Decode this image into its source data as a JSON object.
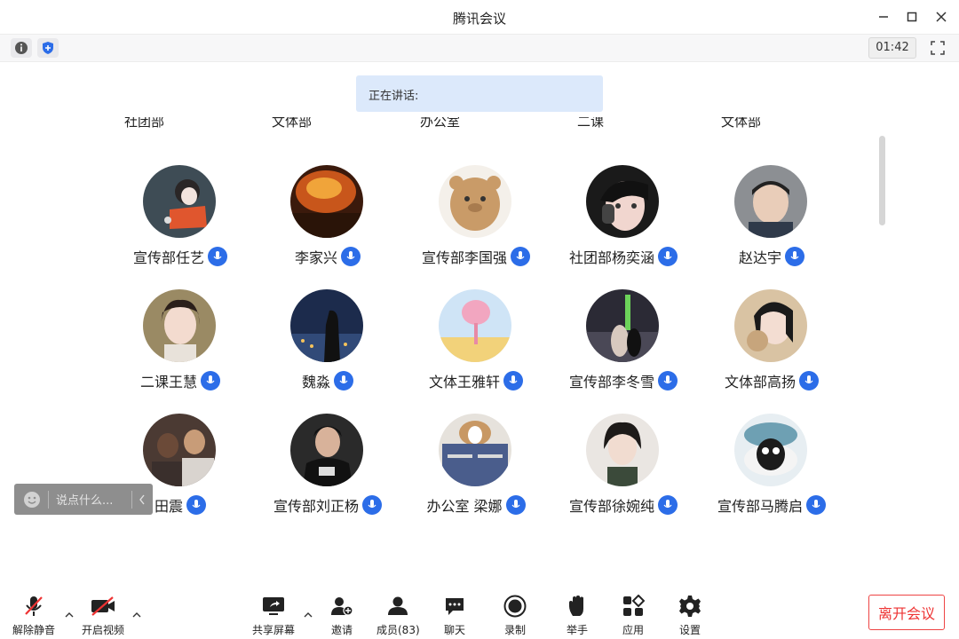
{
  "window": {
    "title": "腾讯会议"
  },
  "toolbar": {
    "timer": "01:42"
  },
  "speaking": {
    "label": "正在讲话:"
  },
  "gallery": {
    "partial_top_row": [
      "社团部",
      "文体部",
      "办公室",
      "二课",
      "文体部"
    ],
    "participants": [
      {
        "name": "宣传部任艺"
      },
      {
        "name": "李家兴"
      },
      {
        "name": "宣传部李国强"
      },
      {
        "name": "社团部杨奕涵"
      },
      {
        "name": "赵达宇"
      },
      {
        "name": "二课王慧"
      },
      {
        "name": "魏淼"
      },
      {
        "name": "文体王雅轩"
      },
      {
        "name": "宣传部李冬雪"
      },
      {
        "name": "文体部高扬"
      },
      {
        "name": "田震"
      },
      {
        "name": "宣传部刘正杨"
      },
      {
        "name": "办公室 梁娜"
      },
      {
        "name": "宣传部徐婉纯"
      },
      {
        "name": "宣传部马腾启"
      }
    ]
  },
  "chat": {
    "placeholder": "说点什么..."
  },
  "bottom": {
    "unmute": "解除静音",
    "video": "开启视频",
    "share": "共享屏幕",
    "invite": "邀请",
    "members": "成员(83)",
    "chat": "聊天",
    "record": "录制",
    "raise_hand": "举手",
    "apps": "应用",
    "settings": "设置",
    "leave": "离开会议"
  },
  "colors": {
    "accent": "#2c6de8",
    "danger": "#e33333",
    "banner": "#dce9fb"
  }
}
